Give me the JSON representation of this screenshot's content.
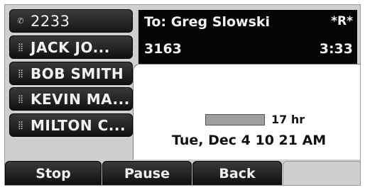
{
  "line_keys": [
    {
      "icon": "phone-line-icon",
      "glyph": "✆",
      "label": "2233"
    },
    {
      "icon": "keypad-icon",
      "glyph": "⣿",
      "label": "JACK JO..."
    },
    {
      "icon": "keypad-icon",
      "glyph": "⣿",
      "label": "BOB SMITH"
    },
    {
      "icon": "keypad-icon",
      "glyph": "⣿",
      "label": "KEVIN MA..."
    },
    {
      "icon": "keypad-icon",
      "glyph": "⣿",
      "label": "MILTON C..."
    }
  ],
  "call": {
    "to": "To: Greg Slowski",
    "flag": "*R*",
    "number": "3163",
    "timer": "3:33"
  },
  "status": {
    "battery_level": 1.0,
    "battery_text": "17 hr",
    "datetime": "Tue, Dec 4  10 21 AM"
  },
  "softkeys": [
    {
      "label": "Stop"
    },
    {
      "label": "Pause"
    },
    {
      "label": "Back"
    },
    {
      "label": ""
    }
  ]
}
